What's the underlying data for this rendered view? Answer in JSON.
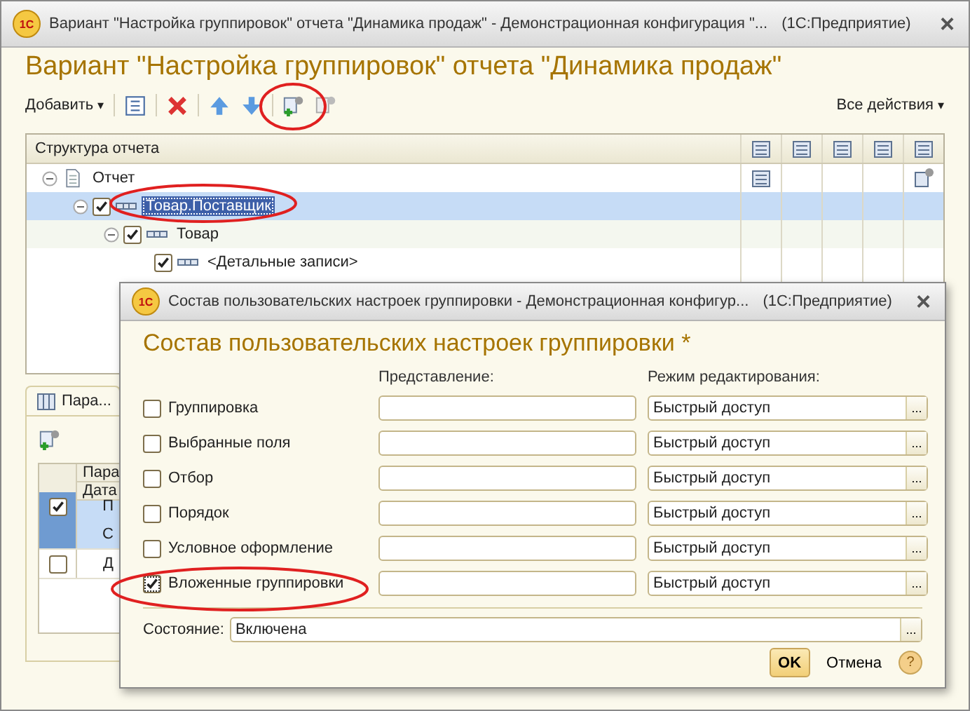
{
  "window": {
    "logo": "1С",
    "title": "Вариант \"Настройка группировок\" отчета \"Динамика продаж\" - Демонстрационная конфигурация \"...",
    "app": "(1С:Предприятие)",
    "close": "×"
  },
  "heading": "Вариант \"Настройка группировок\" отчета \"Динамика продаж\"",
  "toolbar": {
    "add": "Добавить",
    "add_caret": "▾",
    "all_actions": "Все действия",
    "all_actions_caret": "▾"
  },
  "tree": {
    "header": "Структура отчета",
    "items": [
      {
        "label": "Отчет",
        "kind": "report",
        "expanded": true,
        "selected": false,
        "has_fields": true,
        "has_settings": true,
        "children": [
          {
            "label": "Товар.Поставщик",
            "kind": "grouping",
            "checked": true,
            "expanded": true,
            "selected": true,
            "has_fields": false,
            "has_settings": false,
            "children": [
              {
                "label": "Товар",
                "kind": "grouping",
                "checked": true,
                "expanded": true,
                "selected": false,
                "has_fields": false,
                "has_settings": false,
                "children": [
                  {
                    "label": "<Детальные записи>",
                    "kind": "grouping",
                    "checked": true,
                    "selected": false,
                    "has_fields": false,
                    "has_settings": false
                  }
                ]
              }
            ]
          }
        ]
      }
    ]
  },
  "params": {
    "tab": "Пара...",
    "header": [
      "Пара",
      "Дата"
    ],
    "rows": [
      {
        "checked": true,
        "selected": true,
        "lines": [
          "П",
          "С"
        ]
      },
      {
        "checked": false,
        "selected": false,
        "lines": [
          "Д"
        ]
      }
    ]
  },
  "dialog": {
    "logo": "1С",
    "title": "Состав пользовательских настроек группировки - Демонстрационная конфигур...",
    "app": "(1С:Предприятие)",
    "close": "×",
    "heading": "Состав пользовательских настроек группировки *",
    "col_presentation": "Представление:",
    "col_mode": "Режим редактирования:",
    "rows": [
      {
        "label": "Группировка",
        "checked": false,
        "mode": "Быстрый доступ"
      },
      {
        "label": "Выбранные поля",
        "checked": false,
        "mode": "Быстрый доступ"
      },
      {
        "label": "Отбор",
        "checked": false,
        "mode": "Быстрый доступ"
      },
      {
        "label": "Порядок",
        "checked": false,
        "mode": "Быстрый доступ"
      },
      {
        "label": "Условное оформление",
        "checked": false,
        "mode": "Быстрый доступ"
      },
      {
        "label": "Вложенные группировки",
        "checked": true,
        "mode": "Быстрый доступ"
      }
    ],
    "state_label": "Состояние:",
    "state": "Включена",
    "ellipsis": "...",
    "ok": "OK",
    "cancel": "Отмена",
    "help": "?"
  }
}
